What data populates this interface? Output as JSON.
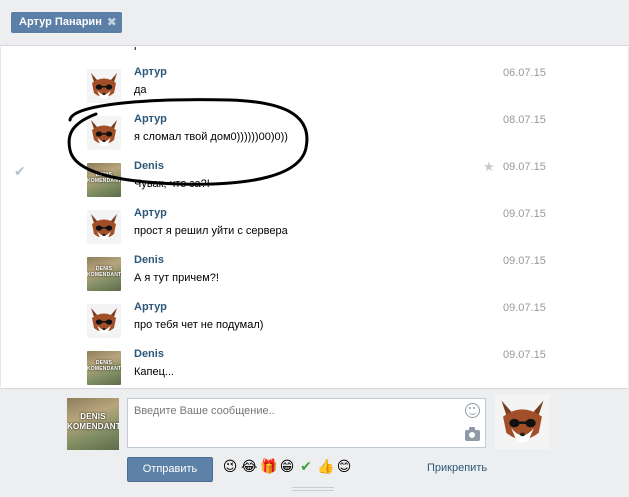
{
  "tab": {
    "title": "Артур Панарин",
    "close_icon": "close-icon"
  },
  "cut_text": "г",
  "messages": [
    {
      "author": "Артур",
      "text": "да",
      "date": "06.07.15",
      "avatar": "fox"
    },
    {
      "author": "Артур",
      "text": "я сломал твой дом0))))))00)0))",
      "date": "08.07.15",
      "avatar": "fox"
    },
    {
      "author": "Denis",
      "text": "Чувак, что за?!",
      "date": "09.07.15",
      "avatar": "denis",
      "read_icon": "checkmark-icon",
      "star_icon": "star-icon"
    },
    {
      "author": "Артур",
      "text": "прост я решил уйти с сервера",
      "date": "09.07.15",
      "avatar": "fox"
    },
    {
      "author": "Denis",
      "text": "А я тут причем?!",
      "date": "09.07.15",
      "avatar": "denis"
    },
    {
      "author": "Артур",
      "text": "про тебя чет не подумал)",
      "date": "09.07.15",
      "avatar": "fox"
    },
    {
      "author": "Denis",
      "text": "Капец...",
      "date": "09.07.15",
      "avatar": "denis"
    }
  ],
  "avatar_labels": {
    "denis_line1": "DENIS",
    "denis_line2": "KOMENDANTOV"
  },
  "composer": {
    "placeholder": "Введите Ваше сообщение..",
    "send_label": "Отправить",
    "attach_label": "Прикрепить",
    "emojis": [
      "😉",
      "😂",
      "🎁",
      "😁",
      "✔",
      "👍",
      "😊"
    ]
  },
  "colors": {
    "accent": "#5b7fa6",
    "link": "#2b587a",
    "date": "#999999",
    "annotation": "#000000"
  }
}
